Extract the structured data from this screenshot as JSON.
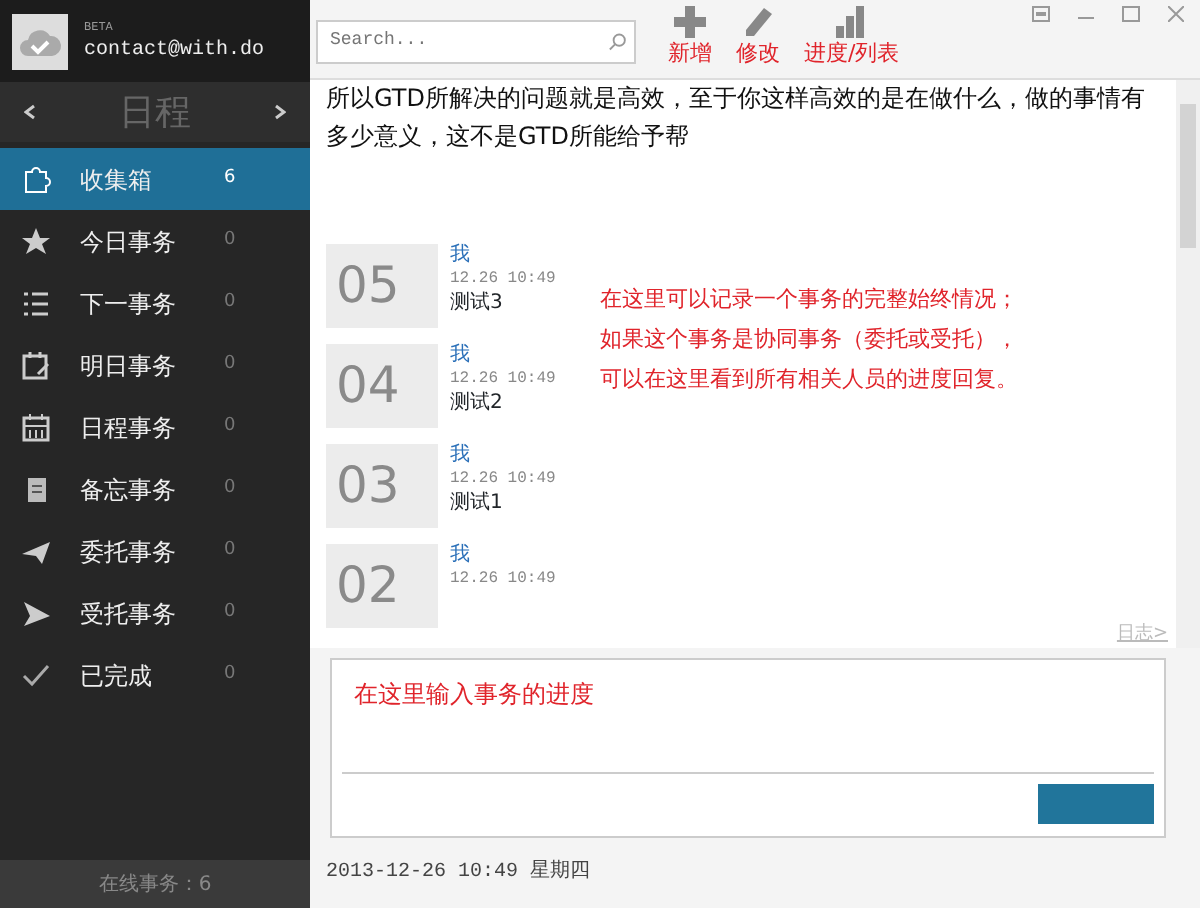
{
  "app": {
    "badge": "BETA",
    "email": "contact@with.do"
  },
  "nav": {
    "title": "日程"
  },
  "sidebar": {
    "items": [
      {
        "label": "收集箱",
        "count": "6",
        "selected": true
      },
      {
        "label": "今日事务",
        "count": "0",
        "selected": false
      },
      {
        "label": "下一事务",
        "count": "0",
        "selected": false
      },
      {
        "label": "明日事务",
        "count": "0",
        "selected": false
      },
      {
        "label": "日程事务",
        "count": "0",
        "selected": false
      },
      {
        "label": "备忘事务",
        "count": "0",
        "selected": false
      },
      {
        "label": "委托事务",
        "count": "0",
        "selected": false
      },
      {
        "label": "受托事务",
        "count": "0",
        "selected": false
      },
      {
        "label": "已完成",
        "count": "0",
        "selected": false
      }
    ],
    "status": "在线事务：6"
  },
  "toolbar": {
    "search": {
      "placeholder": "Search..."
    },
    "buttons": [
      {
        "label": "新增"
      },
      {
        "label": "修改"
      },
      {
        "label": "进度/列表"
      }
    ]
  },
  "content": {
    "intro": "所以GTD所解决的问题就是高效，至于你这样高效的是在做什么，做的事情有多少意义，这不是GTD所能给予帮",
    "entries": [
      {
        "number": "05",
        "author": "我",
        "time": "12.26 10:49",
        "text": "测试3"
      },
      {
        "number": "04",
        "author": "我",
        "time": "12.26 10:49",
        "text": "测试2"
      },
      {
        "number": "03",
        "author": "我",
        "time": "12.26 10:49",
        "text": "测试1"
      },
      {
        "number": "02",
        "author": "我",
        "time": "12.26 10:49"
      }
    ],
    "annotation": [
      "在这里可以记录一个事务的完整始终情况；",
      "如果这个事务是协同事务（委托或受托），",
      "可以在这里看到所有相关人员的进度回复。"
    ],
    "log_link": "日志>"
  },
  "editor": {
    "placeholder": "在这里输入事务的进度"
  },
  "footer": {
    "datetime": "2013-12-26 10:49 星期四"
  }
}
